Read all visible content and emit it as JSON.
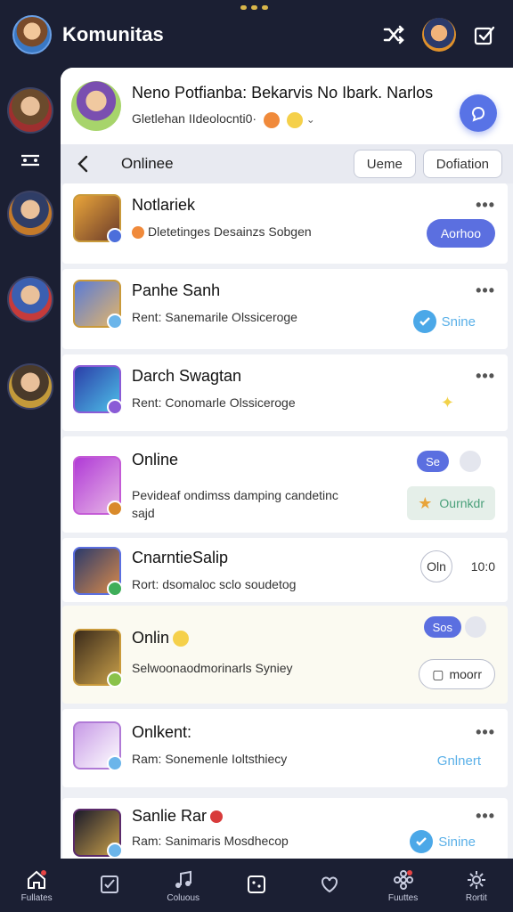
{
  "app": {
    "title": "Komunitas"
  },
  "banner": {
    "title": "Neno Potfianba: Bekarvis No Ibark.  Narlos",
    "subtitle": "Gletlehan IIdeolocnti0·"
  },
  "section": {
    "title": "Onlinee",
    "filters": [
      "Ueme",
      "Dofiation"
    ]
  },
  "contacts": [
    {
      "name": "Notlariek",
      "status": "Dletetinges Desainzs Sobgen",
      "action": "Aorhoo"
    },
    {
      "name": "Panhe Sanh",
      "status": "Rent: Sanemarile  Olssiceroge",
      "tag": "Snine"
    },
    {
      "name": "Darch Swagtan",
      "status": "Rent: Conomarle  Olssiceroge"
    },
    {
      "name": "Online",
      "status": "Pevideaf ondimss damping candetinc",
      "status2": "sajd",
      "pill": "Se",
      "action": "Ournkdr"
    },
    {
      "name": "CnarntieSalip",
      "status": "Rort: dsomaloc sclo soudetog",
      "time": "10:0",
      "clock": "Oln"
    },
    {
      "name": "Onlin",
      "status": "Selwoonaodmorinarls Syniey",
      "pill": "Sos",
      "action": "moorr"
    },
    {
      "name": "Onlkent:",
      "status": "Ram: Sonemenle  Ioltsthiecy",
      "tag": "Gnlnert"
    },
    {
      "name": "Sanlie Rar",
      "status": "Ram: Sanimaris  Mosdhecop",
      "tag": "Sinine"
    }
  ],
  "nav": [
    {
      "label": "Fullates",
      "icon": "home-icon"
    },
    {
      "label": "",
      "icon": "checklist-icon"
    },
    {
      "label": "Coluous",
      "icon": "music-icon"
    },
    {
      "label": "",
      "icon": "dice-icon"
    },
    {
      "label": "",
      "icon": "heart-icon"
    },
    {
      "label": "Fuuttes",
      "icon": "flower-icon"
    },
    {
      "label": "Rortit",
      "icon": "gear-flower-icon"
    }
  ]
}
